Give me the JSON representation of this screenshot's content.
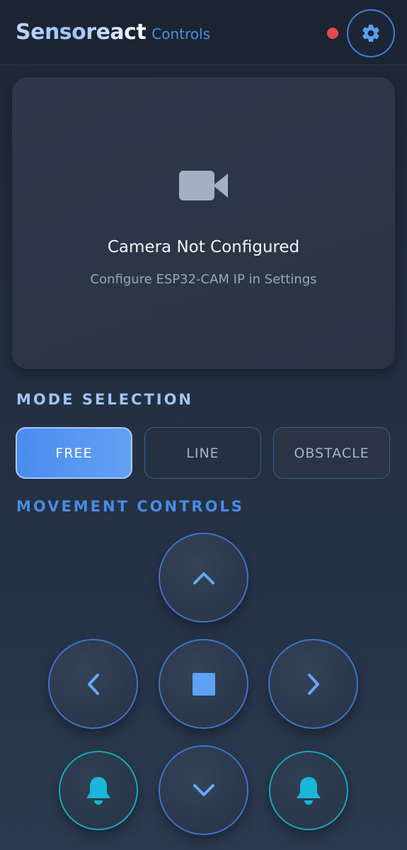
{
  "header": {
    "brand": "Sensoreact",
    "subtitle": "Controls",
    "status_color": "#e24b4b",
    "settings_icon": "gear-icon"
  },
  "camera": {
    "icon": "video-camera-icon",
    "title": "Camera Not Configured",
    "message": "Configure ESP32-CAM IP in Settings"
  },
  "mode_section": {
    "title": "MODE SELECTION",
    "modes": [
      {
        "label": "FREE",
        "selected": true
      },
      {
        "label": "LINE",
        "selected": false
      },
      {
        "label": "OBSTACLE",
        "selected": false
      }
    ]
  },
  "movement_section": {
    "title": "MOVEMENT CONTROLS",
    "controls": {
      "up": "chevron-up-icon",
      "left": "chevron-left-icon",
      "stop": "stop-icon",
      "right": "chevron-right-icon",
      "down": "chevron-down-icon",
      "horn_left": "bell-icon",
      "horn_right": "bell-icon"
    }
  },
  "colors": {
    "accent": "#4a8bf0",
    "bell": "#19b7d8",
    "stop": "#5ea1f3"
  }
}
